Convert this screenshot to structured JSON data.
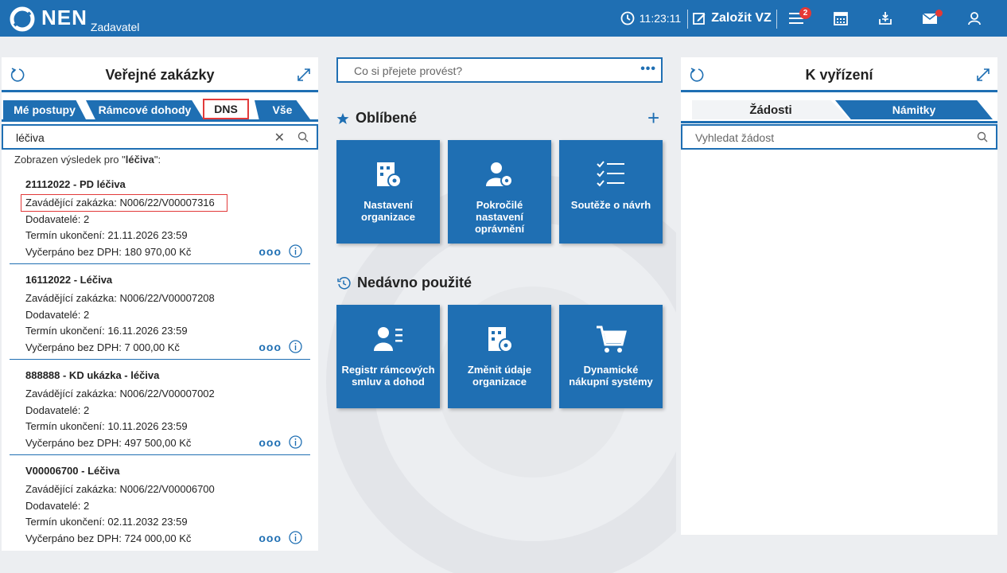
{
  "header": {
    "logo": "NEN",
    "logo_sub": "Zadavatel",
    "time": "11:23:11",
    "create_label": "Založit VZ",
    "menu_badge": "2"
  },
  "left_panel": {
    "title": "Veřejné zakázky",
    "tabs": [
      "Mé postupy",
      "Rámcové dohody",
      "DNS",
      "Vše"
    ],
    "active_tab": "DNS",
    "search_value": "léčiva",
    "result_prefix": "Zobrazen výsledek pro \"",
    "result_term": "léčiva",
    "result_suffix": "\":",
    "items": [
      {
        "title": "21112022 - PD léčiva",
        "zavadejici": "Zavádějící zakázka: N006/22/V00007316",
        "dodavatele": "Dodavatelé: 2",
        "termin": "Termín ukončení: 21.11.2026 23:59",
        "vycerpano": "Vyčerpáno bez DPH: 180 970,00 Kč"
      },
      {
        "title": "16112022 - Léčiva",
        "zavadejici": "Zavádějící zakázka: N006/22/V00007208",
        "dodavatele": "Dodavatelé: 2",
        "termin": "Termín ukončení: 16.11.2026 23:59",
        "vycerpano": "Vyčerpáno bez DPH: 7 000,00 Kč"
      },
      {
        "title": "888888 - KD ukázka - léčiva",
        "zavadejici": "Zavádějící zakázka: N006/22/V00007002",
        "dodavatele": "Dodavatelé: 2",
        "termin": "Termín ukončení: 10.11.2026 23:59",
        "vycerpano": "Vyčerpáno bez DPH: 497 500,00 Kč"
      },
      {
        "title": "V00006700 - Léčiva",
        "zavadejici": "Zavádějící zakázka: N006/22/V00006700",
        "dodavatele": "Dodavatelé: 2",
        "termin": "Termín ukončení: 02.11.2032 23:59",
        "vycerpano": "Vyčerpáno bez DPH: 724 000,00 Kč"
      }
    ]
  },
  "center": {
    "command_placeholder": "Co si přejete provést?",
    "favorites_title": "Oblíbené",
    "favorites": [
      {
        "label": "Nastavení organizace",
        "icon": "organization-settings-icon"
      },
      {
        "label": "Pokročilé nastavení oprávnění",
        "icon": "user-settings-icon"
      },
      {
        "label": "Soutěže o návrh",
        "icon": "checklist-icon"
      }
    ],
    "recent_title": "Nedávno použité",
    "recent": [
      {
        "label": "Registr rámcových smluv a dohod",
        "icon": "user-list-icon"
      },
      {
        "label": "Změnit údaje organizace",
        "icon": "organization-settings-icon"
      },
      {
        "label": "Dynamické nákupní systémy",
        "icon": "cart-icon"
      }
    ]
  },
  "right_panel": {
    "title": "K vyřízení",
    "tabs": [
      "Žádosti",
      "Námitky"
    ],
    "active_tab": "Žádosti",
    "search_placeholder": "Vyhledat žádost"
  },
  "colors": {
    "brand_blue": "#1f6fb3",
    "highlight_red": "#e23a3a",
    "badge_red": "#e53935",
    "background": "#eceef1"
  }
}
